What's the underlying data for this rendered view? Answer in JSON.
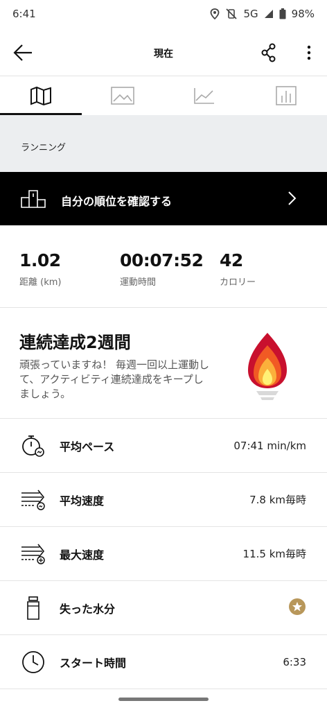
{
  "status_bar": {
    "time": "6:41",
    "network": "5G",
    "battery": "98%",
    "icons": [
      "location-icon",
      "mute-vibrate-icon",
      "signal-icon",
      "battery-icon"
    ]
  },
  "app_bar": {
    "title": "現在",
    "icons": [
      "back-arrow-icon",
      "share-icon",
      "more-icon"
    ]
  },
  "tabs": [
    {
      "name": "map",
      "icon": "map-icon",
      "active": true
    },
    {
      "name": "photo",
      "icon": "image-icon",
      "active": false
    },
    {
      "name": "graph",
      "icon": "line-chart-icon",
      "active": false
    },
    {
      "name": "bars",
      "icon": "bar-chart-icon",
      "active": false
    }
  ],
  "activity_type": "ランニング",
  "ranking_banner": {
    "label": "自分の順位を確認する",
    "icon": "podium-icon"
  },
  "stats": {
    "distance": {
      "value": "1.02",
      "label": "距離 (km)"
    },
    "duration": {
      "value": "00:07:52",
      "label": "運動時間"
    },
    "calories": {
      "value": "42",
      "label": "カロリー"
    }
  },
  "streak": {
    "title": "連続達成2週間",
    "description": "頑張っていますね！ 毎週一回以上運動して、アクティビティ連続達成をキープしましょう。",
    "icon": "torch-flame-icon",
    "colors": {
      "outer": "#c8102e",
      "middle": "#f15a24",
      "inner": "#fbb03b",
      "core": "#fff176"
    }
  },
  "metrics": [
    {
      "label": "平均ペース",
      "value": "07:41 min/km",
      "icon": "stopwatch-pace-icon"
    },
    {
      "label": "平均速度",
      "value": "7.8 km毎時",
      "icon": "speed-average-icon"
    },
    {
      "label": "最大速度",
      "value": "11.5 km毎時",
      "icon": "speed-max-icon"
    },
    {
      "label": "失った水分",
      "value": "",
      "icon": "water-bottle-icon",
      "badge_icon": "premium-star-icon",
      "badge_color": "#b8975a"
    },
    {
      "label": "スタート時間",
      "value": "6:33",
      "icon": "clock-icon"
    }
  ]
}
